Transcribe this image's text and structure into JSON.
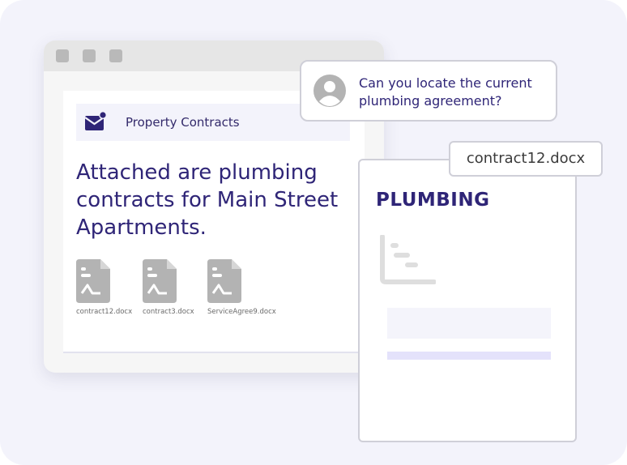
{
  "email": {
    "title": "Property Contracts",
    "message": "Attached are plumbing contracts for Main Street Apartments.",
    "attachments": [
      {
        "name": "contract12.docx",
        "icon": "document-icon"
      },
      {
        "name": "contract3.docx",
        "icon": "document-icon"
      },
      {
        "name": "ServiceAgree9.docx",
        "icon": "document-icon"
      }
    ]
  },
  "chat": {
    "avatar_icon": "user-avatar-icon",
    "message": "Can you locate the current plumbing agreement?"
  },
  "document": {
    "filename": "contract12.docx",
    "title": "PLUMBING",
    "chart_icon": "bar-chart-icon"
  },
  "colors": {
    "accent": "#2f2577",
    "icon_gray": "#b3b3b3",
    "highlight": "#e4e2fb",
    "background": "#f3f3fb"
  }
}
